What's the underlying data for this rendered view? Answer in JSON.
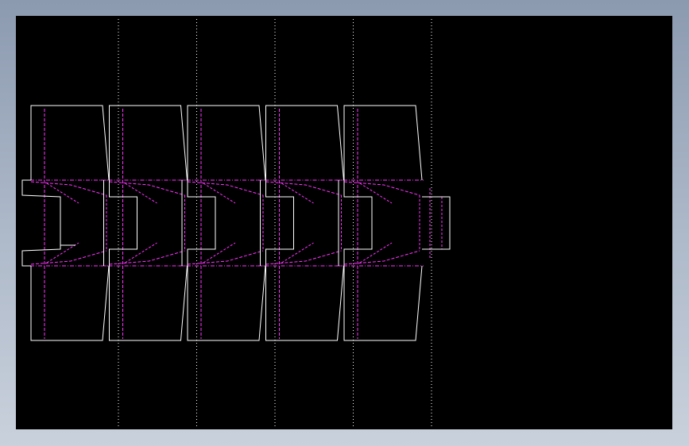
{
  "viewport": {
    "background": "#000000",
    "frame_gradient": [
      "#8c9ab0",
      "#c9d1dc"
    ]
  },
  "drawing": {
    "units": 5,
    "line_colors": {
      "outline": "#ffffff",
      "hidden": "#ff33ff",
      "centerline": "#ffffff"
    }
  }
}
